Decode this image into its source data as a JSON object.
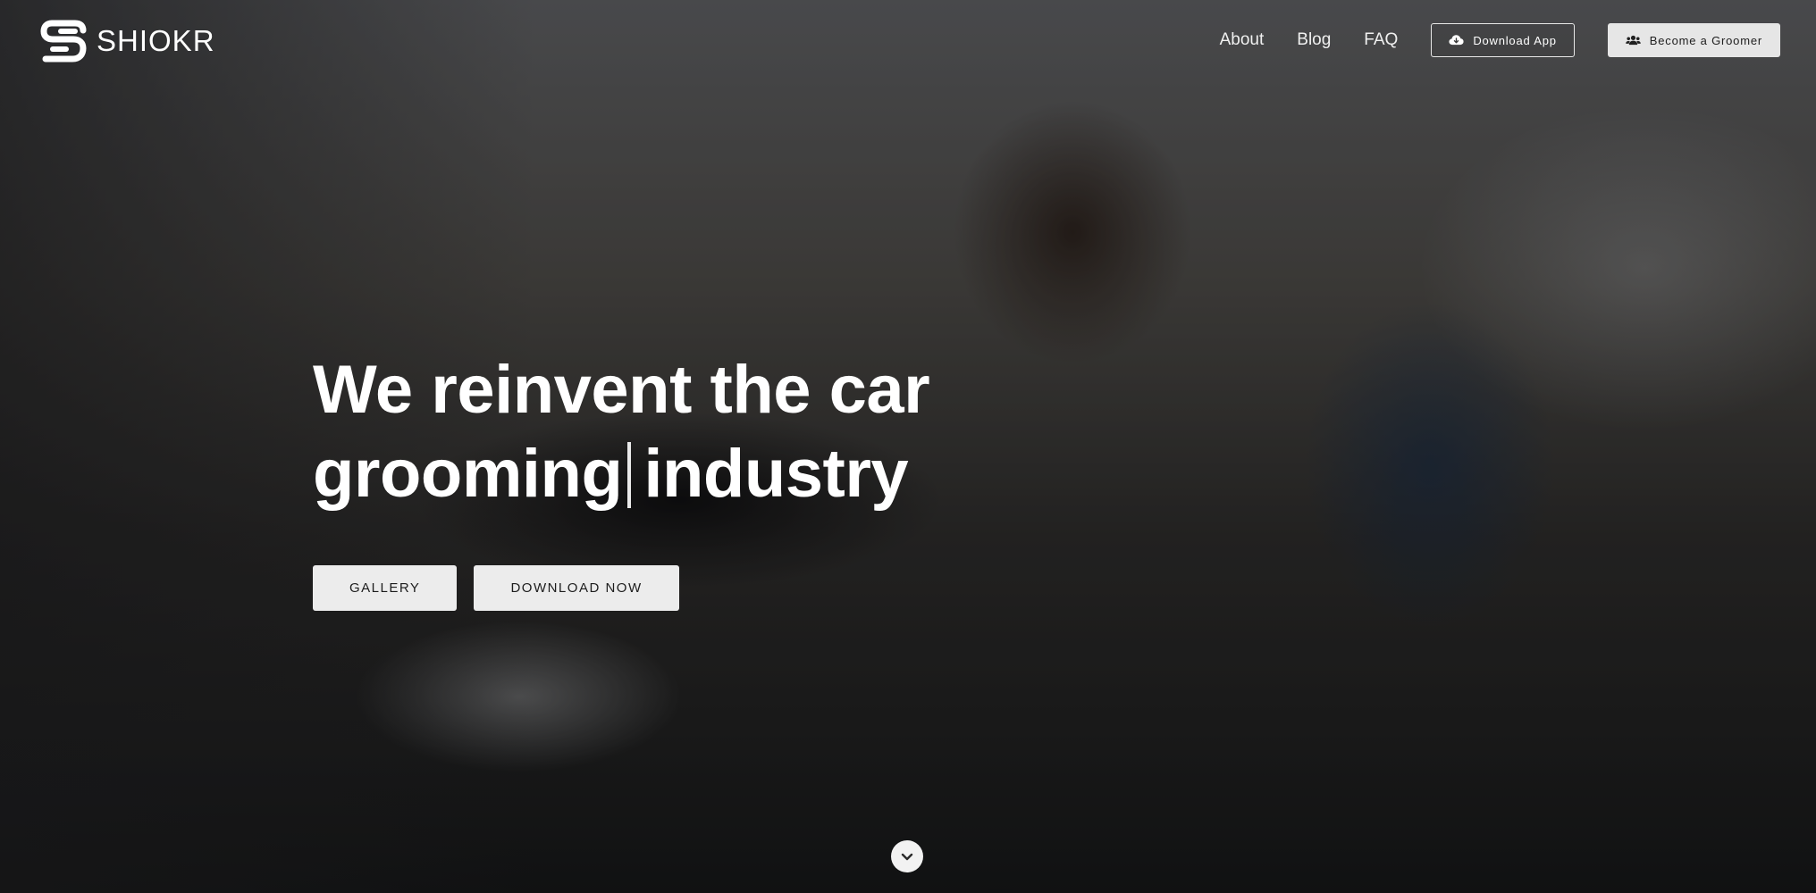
{
  "brand": {
    "name": "SHIOKR",
    "logo_icon": "shiokr-s-logo-icon"
  },
  "nav": {
    "links": [
      "About",
      "Blog",
      "FAQ"
    ],
    "download_app": {
      "label": "Download App",
      "icon": "cloud-download-icon"
    },
    "become_groomer": {
      "label": "Become a Groomer",
      "icon": "users-icon"
    }
  },
  "hero": {
    "headline_line1": "We reinvent the car",
    "headline_word": "grooming",
    "headline_line2_end": "industry",
    "buttons": {
      "gallery": "GALLERY",
      "download_now": "DOWNLOAD NOW"
    },
    "scroll_icon": "chevron-down-icon"
  },
  "colors": {
    "text": "#ffffff",
    "button_bg": "#ececec",
    "button_text": "#1d1d1d"
  }
}
